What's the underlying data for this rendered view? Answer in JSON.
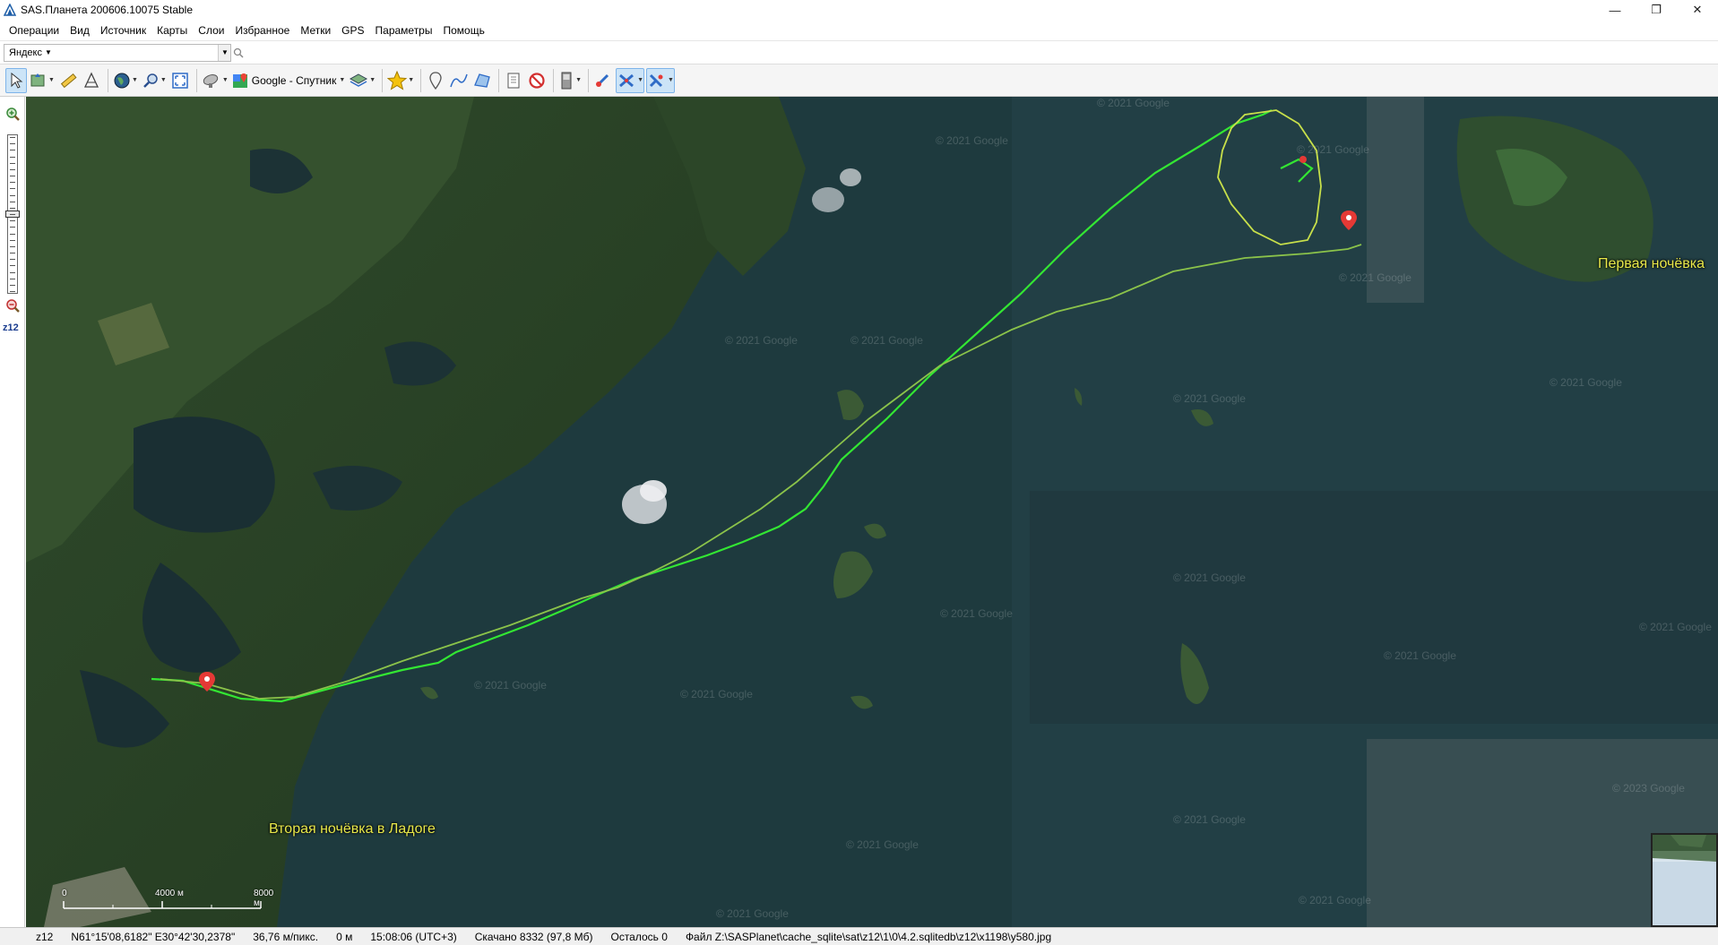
{
  "window": {
    "title": "SAS.Планета 200606.10075 Stable",
    "controls": {
      "minimize": "—",
      "maximize": "❐",
      "close": "✕"
    }
  },
  "menu": {
    "items": [
      "Операции",
      "Вид",
      "Источник",
      "Карты",
      "Слои",
      "Избранное",
      "Метки",
      "GPS",
      "Параметры",
      "Помощь"
    ]
  },
  "search": {
    "engine": "Яндекс",
    "query": "",
    "placeholder": ""
  },
  "toolbar": {
    "map_source_label": "Google - Спутник"
  },
  "left_panel": {
    "zoom_label": "z12",
    "zoom_level": 12,
    "zoom_max": 24
  },
  "map": {
    "placemarks": [
      {
        "label": "Первая ночёвка"
      },
      {
        "label": "Вторая ночёвка в Ладоге"
      }
    ],
    "watermark": "© 2021 Google",
    "watermark_alt": "© 2023 Google",
    "scale": {
      "zero": "0",
      "mid": "4000 м",
      "end": "8000 м"
    },
    "colors": {
      "track_bright": "#33e633",
      "track_olive": "#8bc34a",
      "track_yellow": "#c8e04a",
      "placemark": "#e53935",
      "label": "#e8e84a"
    }
  },
  "status": {
    "zoom": "z12",
    "coords": "N61°15'08,6182\" E30°42'30,2378\"",
    "resolution": "36,76 м/пикс.",
    "altitude": "0 м",
    "time": "15:08:06 (UTC+3)",
    "downloaded": "Скачано 8332 (97,8 Мб)",
    "remaining": "Осталось 0",
    "file": "Файл Z:\\SASPlanet\\cache_sqlite\\sat\\z12\\1\\0\\4.2.sqlitedb\\z12\\x1198\\y580.jpg"
  }
}
